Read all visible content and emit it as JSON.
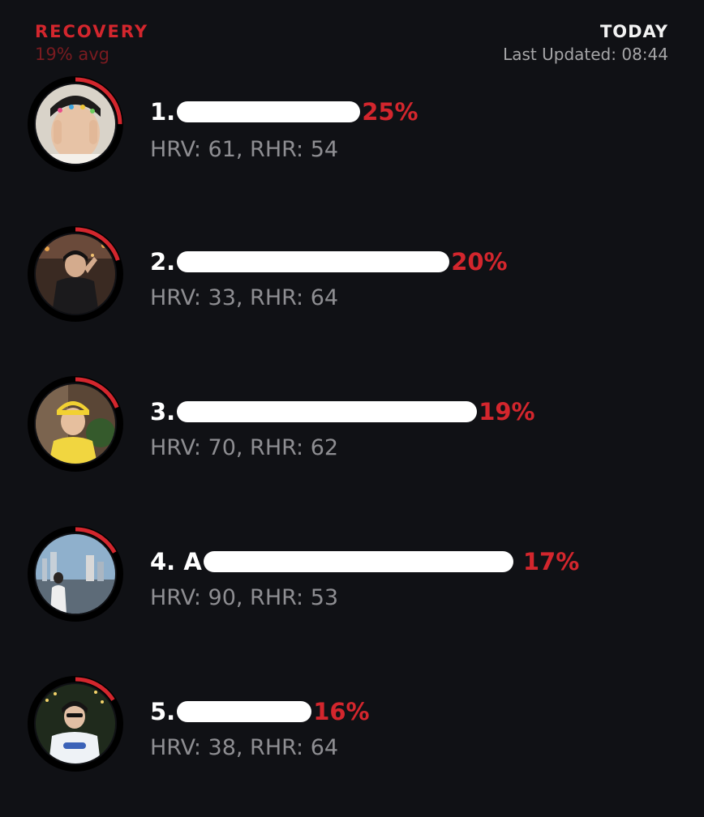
{
  "header": {
    "title": "RECOVERY",
    "subtitle": "19% avg",
    "period": "TODAY",
    "last_updated": "Last Updated: 08:44"
  },
  "colors": {
    "background": "#101115",
    "accent_red": "#d3262d",
    "muted_red": "#7a1b20",
    "stat_gray": "#8e8e92",
    "ring_track": "#000000"
  },
  "rows": [
    {
      "rank": "1.",
      "name_prefix": "",
      "percent": "25%",
      "recovery": 0.25,
      "stats": "HRV: 61, RHR: 54",
      "avatar_icon": "user-avatar-photo"
    },
    {
      "rank": "2.",
      "name_prefix": "",
      "percent": "20%",
      "recovery": 0.2,
      "stats": "HRV: 33, RHR: 64",
      "avatar_icon": "user-avatar-photo"
    },
    {
      "rank": "3.",
      "name_prefix": "",
      "percent": "19%",
      "recovery": 0.19,
      "stats": "HRV: 70, RHR: 62",
      "avatar_icon": "user-avatar-photo"
    },
    {
      "rank": "4.",
      "name_prefix": "A",
      "percent": "17%",
      "recovery": 0.17,
      "stats": "HRV: 90, RHR: 53",
      "avatar_icon": "user-avatar-photo"
    },
    {
      "rank": "5.",
      "name_prefix": "",
      "percent": "16%",
      "recovery": 0.16,
      "stats": "HRV: 38, RHR: 64",
      "avatar_icon": "user-avatar-photo"
    }
  ]
}
